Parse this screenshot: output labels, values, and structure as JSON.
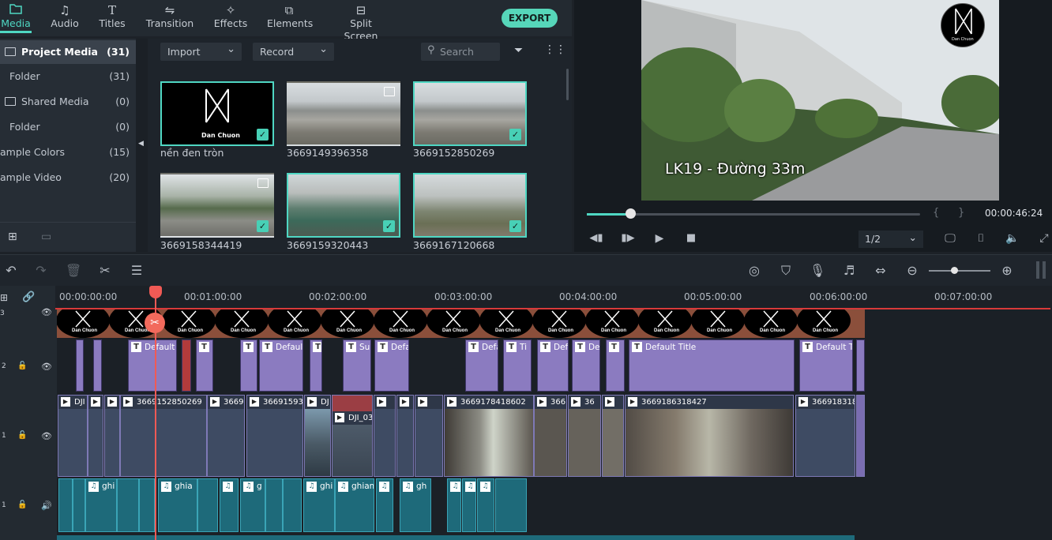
{
  "nav": {
    "tabs": [
      {
        "label": "Media",
        "icon": "folder-icon"
      },
      {
        "label": "Audio",
        "icon": "music-note-icon"
      },
      {
        "label": "Titles",
        "icon": "text-t-icon"
      },
      {
        "label": "Transition",
        "icon": "transition-icon"
      },
      {
        "label": "Effects",
        "icon": "sparkle-icon"
      },
      {
        "label": "Elements",
        "icon": "elements-icon"
      },
      {
        "label": "Split Screen",
        "icon": "split-screen-icon"
      }
    ],
    "export_label": "EXPORT"
  },
  "library": {
    "items": [
      {
        "label": "Project Media",
        "count": "(31)"
      },
      {
        "label": "Folder",
        "count": "(31)"
      },
      {
        "label": "Shared Media",
        "count": "(0)"
      },
      {
        "label": "Folder",
        "count": "(0)"
      },
      {
        "label": "ample Colors",
        "count": "(15)"
      },
      {
        "label": "ample Video",
        "count": "(20)"
      }
    ]
  },
  "media": {
    "import_label": "Import",
    "record_label": "Record",
    "search_placeholder": "Search",
    "items": [
      {
        "name": "nền đen tròn",
        "selected": true
      },
      {
        "name": "3669149396358",
        "selected": false
      },
      {
        "name": "3669152850269",
        "selected": true
      },
      {
        "name": "3669158344419",
        "selected": true
      },
      {
        "name": "3669159320443",
        "selected": true
      },
      {
        "name": "3669167120668",
        "selected": true
      }
    ],
    "logo_text": "Dan Chuon"
  },
  "preview": {
    "caption": "LK19 - Đường 33m",
    "timecode": "00:00:46:24",
    "ratio": "1/2",
    "progress": 0.13,
    "logo_text": "Dan Chuon"
  },
  "timeline": {
    "ruler": [
      "00:00:00:00",
      "00:01:00:00",
      "00:02:00:00",
      "00:03:00:00",
      "00:04:00:00",
      "00:05:00:00",
      "00:06:00:00",
      "00:07:00:00"
    ],
    "track_numbers": [
      "3",
      "2",
      "1",
      "1"
    ],
    "title_clips": [
      "Default T",
      "Su",
      "Defa",
      "Defa",
      "Ti",
      "Def",
      "De",
      "Default Title",
      "Default Ti",
      "Default"
    ],
    "video_clips": [
      "DJI",
      "3669152850269",
      "3669",
      "36691593",
      "DJ",
      "DJI_03",
      "3669178418602",
      "366",
      "36",
      "3669186318427",
      "366918318"
    ],
    "audio_clips": [
      "ghi",
      "ghia",
      "g",
      "ghi",
      "ghiam",
      "gh"
    ],
    "overlay_logo": "Dan Chuon"
  }
}
